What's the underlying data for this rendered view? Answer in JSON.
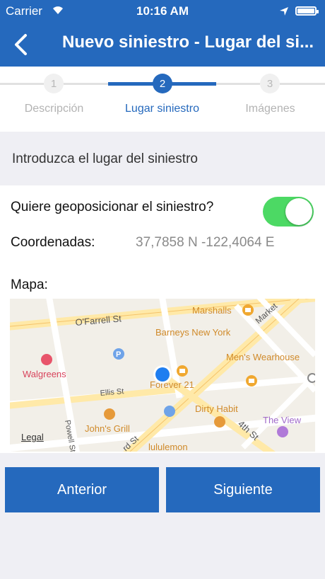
{
  "status_bar": {
    "carrier": "Carrier",
    "time": "10:16 AM"
  },
  "nav": {
    "title": "Nuevo siniestro - Lugar del si..."
  },
  "steps": [
    {
      "number": "1",
      "label": "Descripción"
    },
    {
      "number": "2",
      "label": "Lugar siniestro"
    },
    {
      "number": "3",
      "label": "Imágenes"
    }
  ],
  "section": {
    "title": "Introduzca el lugar del siniestro"
  },
  "form": {
    "geoposition_label": "Quiere geoposicionar el siniestro?",
    "geoposition_enabled": true,
    "coords_label": "Coordenadas:",
    "coords_value": "37,7858 N -122,4064 E",
    "map_label": "Mapa:"
  },
  "map": {
    "legal": "Legal",
    "streets": [
      "O'Farrell St",
      "Ellis St",
      "Powell St",
      "Market",
      "4th St",
      "rd St"
    ],
    "places": [
      "Marshalls",
      "Barneys New York",
      "Men's Wearhouse",
      "Walgreens",
      "Forever 21",
      "Dirty Habit",
      "John's Grill",
      "The View",
      "lululemon"
    ],
    "parking": "P"
  },
  "buttons": {
    "previous": "Anterior",
    "next": "Siguiente"
  },
  "colors": {
    "primary": "#2569bd",
    "toggle_on": "#4cd964",
    "poi": "#e69a3a",
    "shop": "#f0a830"
  }
}
